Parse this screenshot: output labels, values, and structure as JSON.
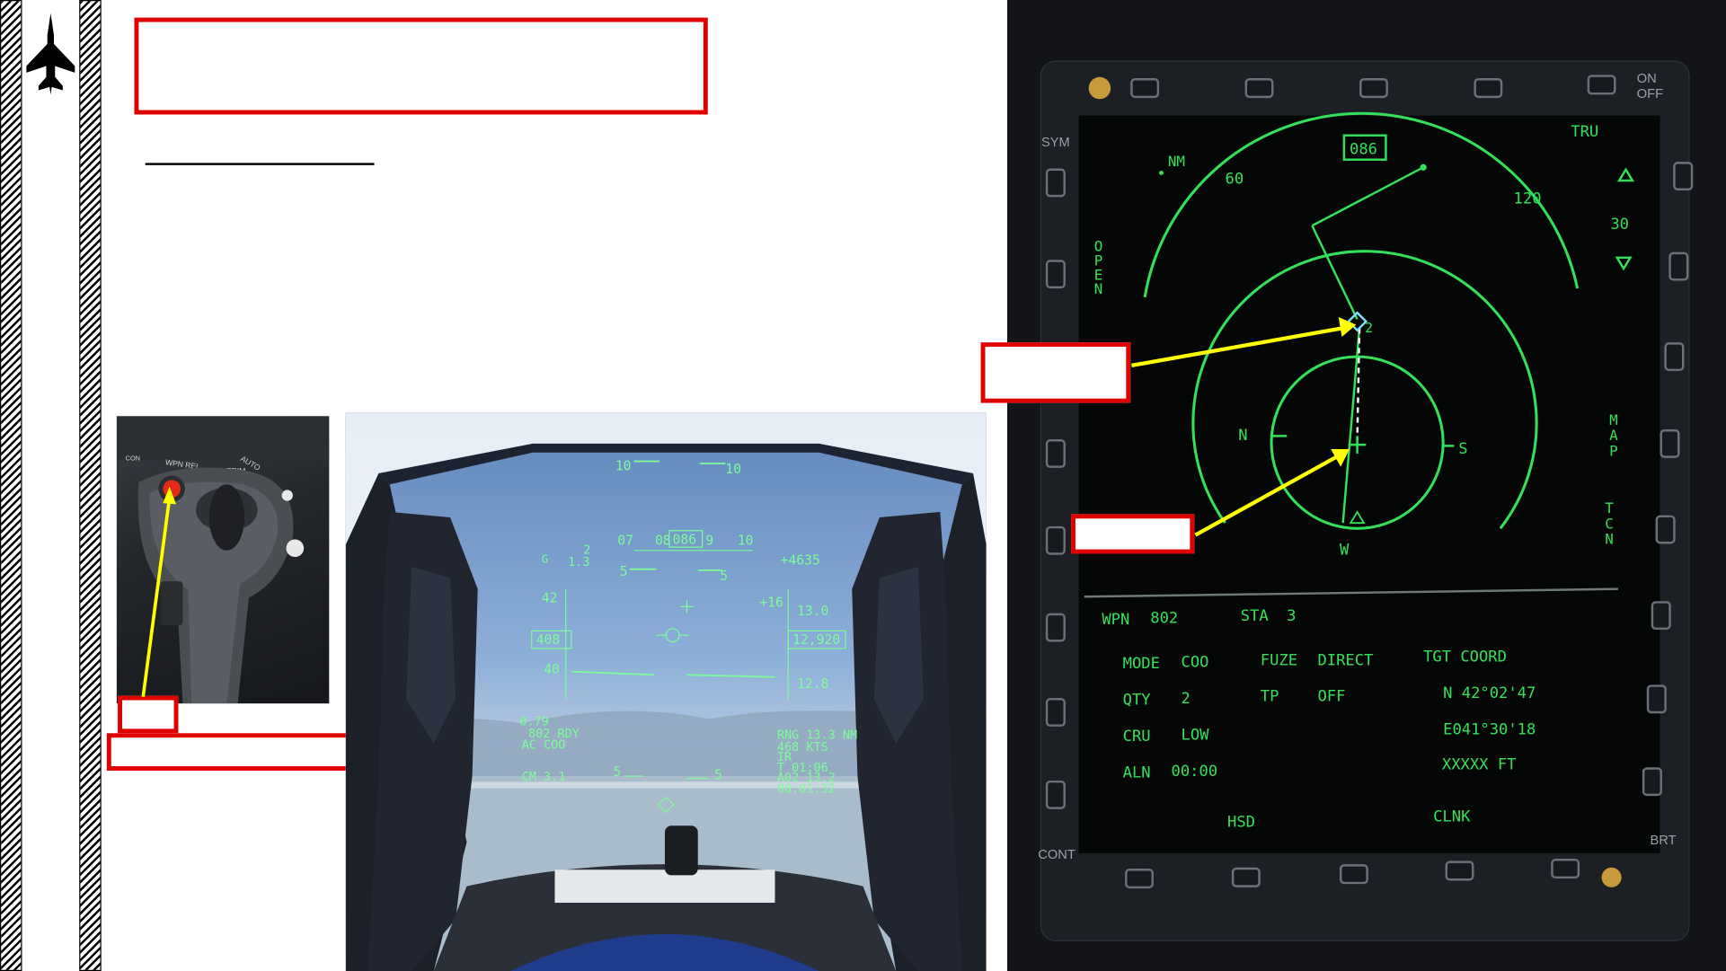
{
  "slide": {
    "title_box_text": "",
    "subtitle_text": "",
    "callout_labels": {
      "stick_button": "",
      "stick_caption": "",
      "waypoint": "",
      "aircraft": ""
    }
  },
  "sidebar": {
    "logo": "jet-silhouette-icon"
  },
  "stick_photo": {
    "labels": [
      "WPN REL",
      "AUTO",
      "TRIM",
      "CON"
    ]
  },
  "hud": {
    "pitch_top_left": "10",
    "pitch_top_right": "10",
    "heading_ticks": [
      "07",
      "08",
      "086",
      "9",
      "10"
    ],
    "heading_value": "086",
    "g_label": "G",
    "g_current": "2",
    "g_value": "1.3",
    "altitude_alt": "+4635",
    "vsi": "+16",
    "alt_scale_top": "13.0",
    "alt_box": "12,920",
    "alt_scale_bottom": "12.8",
    "spd_top": "42",
    "spd_box": "408",
    "spd_bottom": "40",
    "pitch_mid_left": "5",
    "pitch_mid_right": "5",
    "pitch_low_left": "5",
    "pitch_low_right": "5",
    "weapon_line1": "0.79",
    "weapon_line2": "802 RDY",
    "weapon_line3": "AC  COO",
    "weapon_line4": "CM 3.1",
    "rng": "RNG 13.3 NM",
    "gs": "468 KTS",
    "ir": "IR",
    "time1": "T 01:06",
    "wp": "A02 13.2",
    "time2": "08:01:32"
  },
  "mfd": {
    "top_right_label": "ON\nOFF",
    "sym": "SYM",
    "tru": "TRU",
    "heading_box": "086",
    "nm": "NM",
    "compass_60": "60",
    "compass_120": "120",
    "range": "30",
    "open": "OPEN",
    "map": "MAP",
    "tcn": "TCN",
    "card_n": "N",
    "card_s": "S",
    "card_w": "W",
    "wp_num": "2",
    "cont": "CONT",
    "brt": "BRT",
    "wpn": "WPN",
    "wpn_val": "802",
    "sta": "STA",
    "sta_val": "3",
    "mode": "MODE",
    "mode_val": "COO",
    "fuze": "FUZE",
    "fuze_val": "DIRECT",
    "tgt": "TGT COORD",
    "qty": "QTY",
    "qty_val": "2",
    "tp": "TP",
    "tp_val": "OFF",
    "lat": "N 42°02'47",
    "cru": "CRU",
    "cru_val": "LOW",
    "lon": "E041°30'18",
    "aln": "ALN",
    "aln_val": "00:00",
    "elev": "XXXXX FT",
    "hsd": "HSD",
    "clnk": "CLNK"
  },
  "colors": {
    "callout_red": "#e00000",
    "arrow_yellow": "#ffff00",
    "mfd_green": "#34e05a",
    "hud_green": "#7dfc9a"
  }
}
